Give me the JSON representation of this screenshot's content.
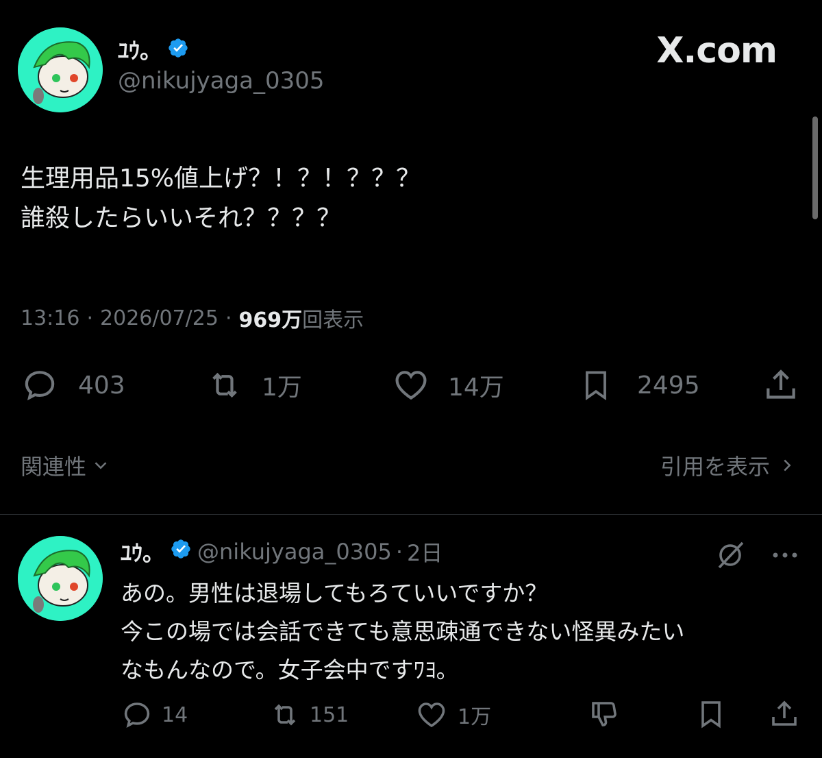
{
  "main_tweet": {
    "display_name": "ﾕｳ。",
    "handle": "@nikujyaga_0305",
    "site_label": "X.com",
    "text_lines": [
      "生理用品15%値上げ？！？！？？？",
      "誰殺したらいいそれ？？？？"
    ],
    "time": "13:16",
    "date": "2026/07/25",
    "views_count": "969万",
    "views_label": "回表示",
    "sep": "·",
    "replies": "403",
    "retweets": "1万",
    "likes": "14万",
    "bookmarks": "2495",
    "relevance_label": "関連性",
    "quotes_label": "引用を表示"
  },
  "reply": {
    "display_name": "ﾕｳ。",
    "handle": "@nikujyaga_0305",
    "time_ago": "2日",
    "sep": "·",
    "text_lines": [
      "あの。男性は退場してもろていいですか？",
      "今この場では会話できても意思疎通できない怪異みたい",
      "なもんなので。女子会中ですﾜﾖ。"
    ],
    "replies": "14",
    "retweets": "151",
    "likes": "1万"
  },
  "colors": {
    "background": "#000000",
    "text": "#e7e9ea",
    "muted": "#71767b",
    "verified": "#1d9bf0",
    "avatar": "#2ef2c4"
  }
}
